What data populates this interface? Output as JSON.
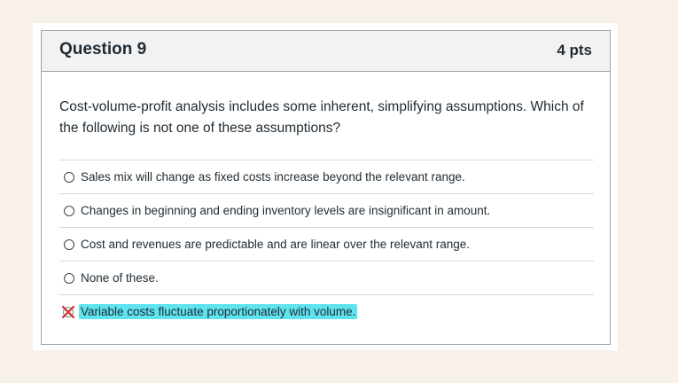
{
  "question": {
    "title": "Question 9",
    "points": "4 pts",
    "text": "Cost-volume-profit analysis includes some inherent, simplifying assumptions.  Which of the following is not one of these assumptions?"
  },
  "answers": [
    {
      "label": "Sales mix will change as fixed costs increase beyond the relevant range."
    },
    {
      "label": "Changes in beginning and ending inventory levels are insignificant in amount."
    },
    {
      "label": "Cost and revenues are predictable and are linear over the relevant range."
    },
    {
      "label": "None of these."
    },
    {
      "label": "Variable costs fluctuate proportionately with volume.",
      "marked": "incorrect",
      "highlight_color": "#5fe3ef"
    }
  ],
  "icons": {
    "radio": "radio-button-icon",
    "incorrect": "incorrect-x-icon"
  }
}
